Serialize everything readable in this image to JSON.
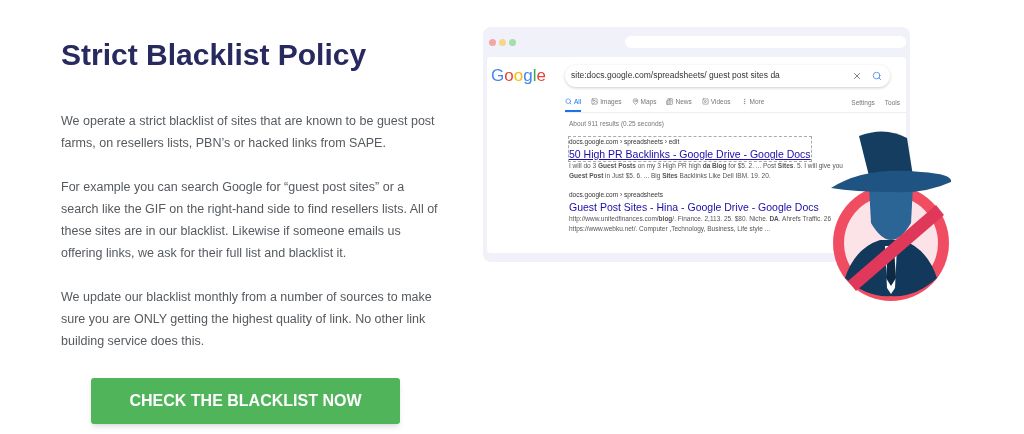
{
  "heading": "Strict Blacklist Policy",
  "paragraphs": [
    "We operate a strict blacklist of sites that are known to be guest post farms, on resellers lists, PBN’s or hacked links from SAPE.",
    "For example you can search Google for “guest post sites” or a search like the GIF on the right-hand side to find resellers lists.  All of these sites are in our blacklist.  Likewise if someone emails us offering links, we ask for their full list and blacklist it.",
    "We update our blacklist monthly from a number of sources to make sure you are ONLY getting the highest quality of link.  No other link building service does this."
  ],
  "cta": "CHECK THE BLACKLIST NOW",
  "search_screenshot": {
    "logo": "Google",
    "query": "site:docs.google.com/spreadsheets/ guest post sites da",
    "tabs": [
      {
        "label": "All",
        "selected": true
      },
      {
        "label": "Images",
        "selected": false
      },
      {
        "label": "Maps",
        "selected": false
      },
      {
        "label": "News",
        "selected": false
      },
      {
        "label": "Videos",
        "selected": false
      },
      {
        "label": "More",
        "selected": false
      }
    ],
    "tools": [
      "Settings",
      "Tools"
    ],
    "result_count": "About 911 results (0.25 seconds)",
    "results": [
      {
        "breadcrumb": "docs.google.com › spreadsheets › edit",
        "title": "50 High PR Backlinks - Google Drive - Google Docs",
        "focused": true,
        "snippet": [
          "I will do 3 **Guest Posts** on my 3 High PR high **da Blog** for $5. 2. ... Post **Sites**. 5. I will give you",
          "**Guest Post** in Just $5. 6. ... Big **Sites** Backlinks Like Dell IBM. 19. 20."
        ]
      },
      {
        "breadcrumb": "docs.google.com › spreadsheets",
        "title": "Guest Post Sites - Hina - Google Drive - Google Docs",
        "focused": false,
        "snippet": [
          "http://www.unitedfinances.com/**blog**/. Finance. 2,113. 25. $80. Niche. **DA**. Ahrefs Traffic. 26",
          "https://www.webku.net/. Computer ,Technology, Business, Life style ..."
        ]
      }
    ]
  }
}
